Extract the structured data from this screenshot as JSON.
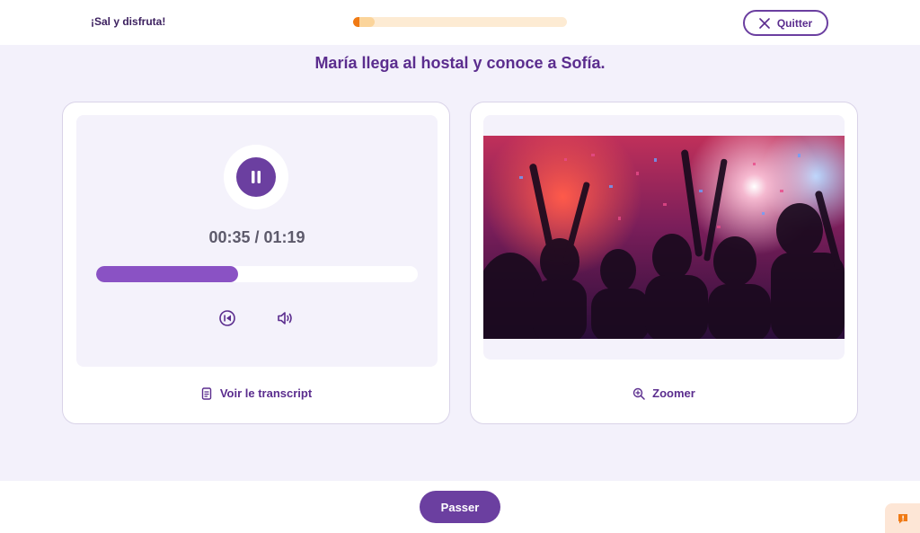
{
  "header": {
    "brand": "¡Sal y disfruta!",
    "progress": 0.1,
    "quit_label": "Quitter"
  },
  "title": "María llega al hostal y conoce a Sofía.",
  "audio": {
    "current_time": "00:35",
    "separator": " / ",
    "duration": "01:19",
    "played_fraction": 0.44,
    "transcript_label": "Voir le transcript"
  },
  "image": {
    "zoom_label": "Zoomer"
  },
  "footer": {
    "next_label": "Passer"
  },
  "colors": {
    "primary": "#6b3fa0",
    "progress_accent": "#f07a14",
    "audio_fill": "#8a52c4"
  },
  "icons": {
    "quit": "close-icon",
    "play_state": "pause-icon",
    "restart": "restart-icon",
    "volume": "volume-icon",
    "transcript": "document-icon",
    "zoom": "zoom-in-icon",
    "feedback": "feedback-icon"
  }
}
